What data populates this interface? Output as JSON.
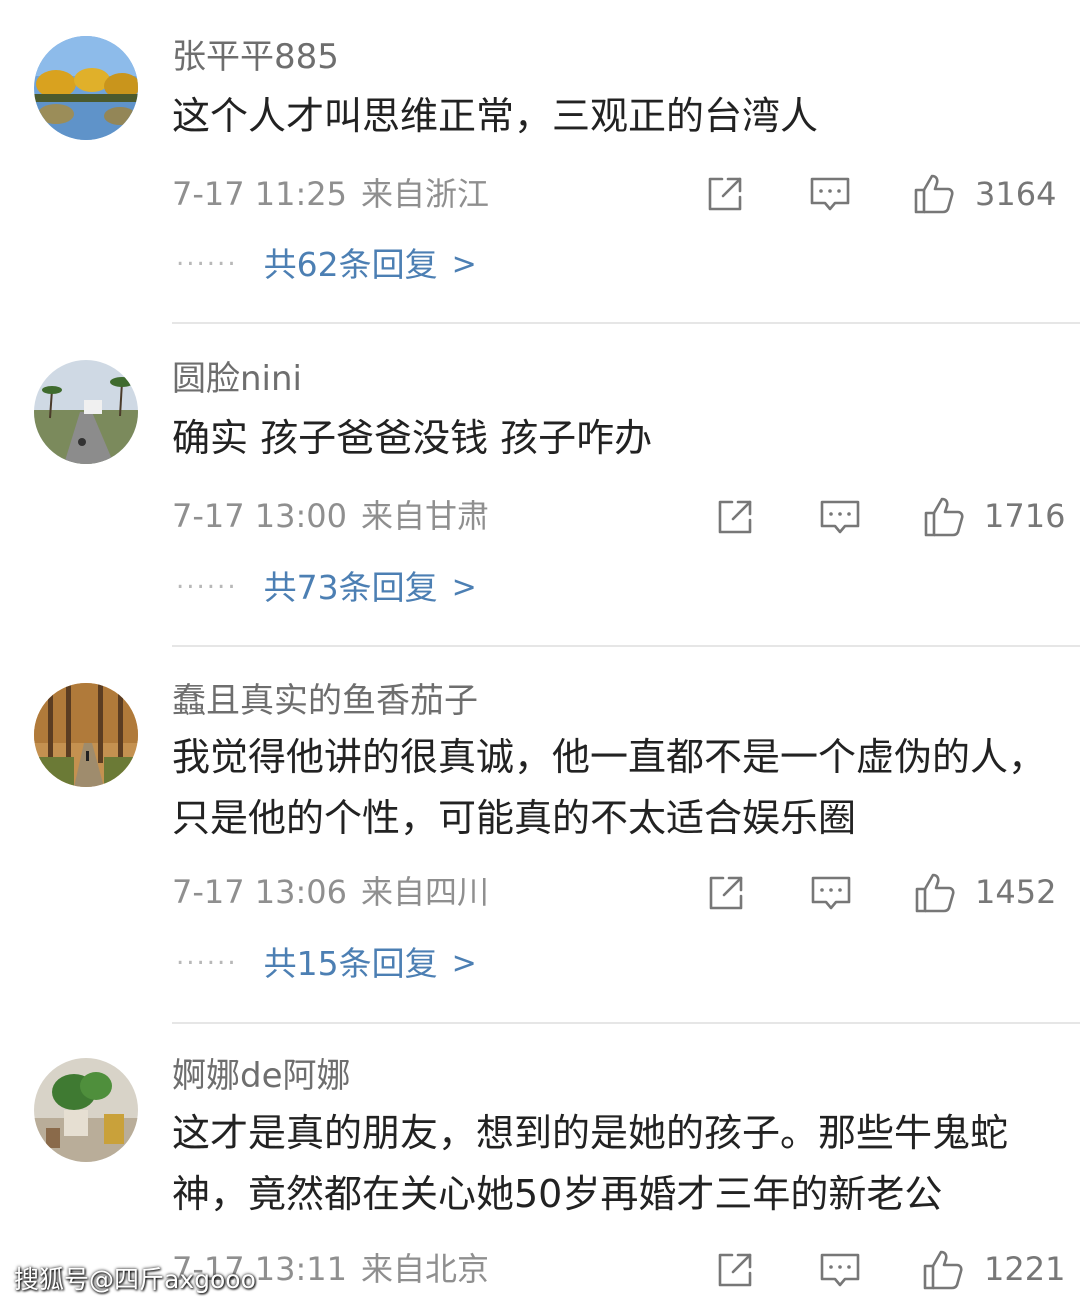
{
  "comments": [
    {
      "username": "张平平885",
      "text": "这个人才叫思维正常，三观正的台湾人",
      "date": "7-17 11:25",
      "location": "来自浙江",
      "likes": "3164",
      "replies": "共62条回复",
      "avatar_icon": "autumn-trees-lake-photo"
    },
    {
      "username": "圆脸nini",
      "text": "确实  孩子爸爸没钱 孩子咋办",
      "date": "7-17 13:00",
      "location": "来自甘肃",
      "likes": "1716",
      "replies": "共73条回复",
      "avatar_icon": "palm-road-photo"
    },
    {
      "username": "蠢且真实的鱼香茄子",
      "text": "我觉得他讲的很真诚，他一直都不是一个虚伪的人，只是他的个性，可能真的不太适合娱乐圈",
      "date": "7-17 13:06",
      "location": "来自四川",
      "likes": "1452",
      "replies": "共15条回复",
      "avatar_icon": "autumn-forest-path-photo"
    },
    {
      "username": "婀娜de阿娜",
      "text": "这才是真的朋友，想到的是她的孩子。那些牛鬼蛇神，竟然都在关心她50岁再婚才三年的新老公",
      "date": "7-17 13:11",
      "location": "来自北京",
      "likes": "1221",
      "avatar_icon": "potted-plant-photo"
    }
  ],
  "watermark": "搜狐号@四斤axgooo",
  "colors": {
    "username": "#6e6e6e",
    "text": "#222222",
    "meta": "#8f8f8f",
    "replies_link": "#4c7fb3",
    "divider": "#e6e6e6"
  }
}
